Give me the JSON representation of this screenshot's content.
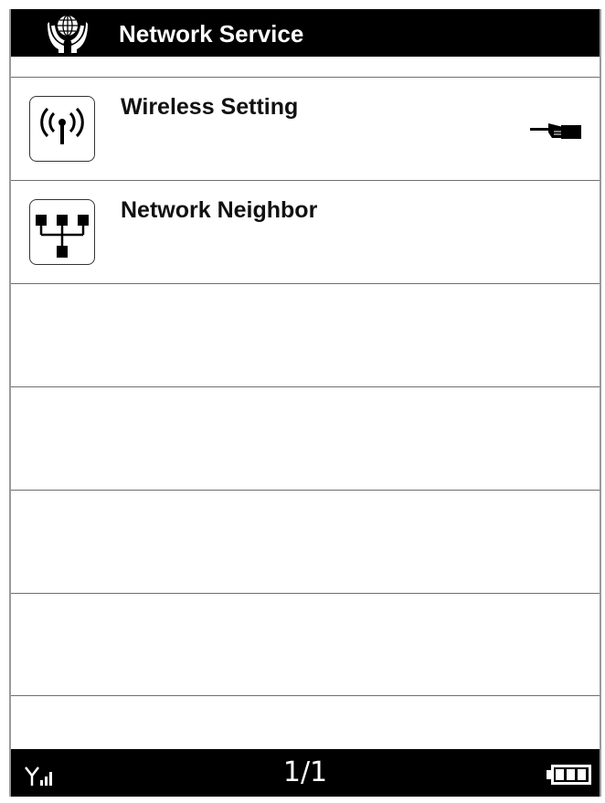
{
  "header": {
    "title": "Network Service",
    "icon": "globe-hands-icon"
  },
  "menu": {
    "items": [
      {
        "label": "Wireless Setting",
        "icon": "wireless-antenna-icon",
        "selected": true
      },
      {
        "label": "Network Neighbor",
        "icon": "network-tree-icon",
        "selected": false
      }
    ],
    "selection_indicator_icon": "pointing-hand-icon"
  },
  "status": {
    "page": "1/1",
    "signal_icon": "signal-strength-icon",
    "battery_icon": "battery-icon"
  },
  "colors": {
    "bar_background": "#000000",
    "bar_text": "#ffffff",
    "divider": "#6f6f6f"
  }
}
